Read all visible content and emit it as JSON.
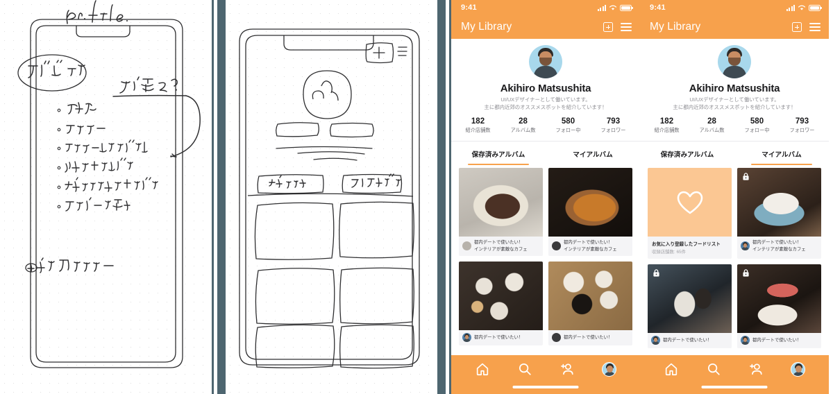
{
  "colors": {
    "accent": "#f7a14c",
    "divider": "#4e6670",
    "fav_bg": "#fbc793",
    "text_dark": "#19191b"
  },
  "sketch_notes": {
    "title": "Pr. file.",
    "circled_label": "プロパティ",
    "tab_change_note": "タブ変え？",
    "bullets": [
      "名前",
      "フォロワー",
      "フォロー中のアカウント",
      "作成したアルバム",
      "お気に入りのアルバム",
      "プロフィール詳細"
    ],
    "footer_note": "◎友だち見てフォロワー"
  },
  "wireframe": {
    "tab_left": "お気に入り",
    "tab_right": "マイアルバム",
    "plus_icon": "plus-box-icon",
    "menu_icon": "hamburger-icon"
  },
  "app": {
    "status": {
      "time": "9:41",
      "signal_icon": "signal-bars-icon",
      "wifi_icon": "wifi-icon",
      "battery_icon": "battery-icon"
    },
    "appbar": {
      "title": "My Library",
      "add_icon": "plus-box-icon",
      "menu_icon": "hamburger-icon"
    },
    "profile": {
      "name": "Akihiro Matsushita",
      "bio_line1": "UI/UXデザイナーとして働いています。",
      "bio_line2": "主に都内近郊のオススメスポットを紹介しています！",
      "avatar": "user-avatar"
    },
    "stats": [
      {
        "value": "182",
        "label": "紹介店舗数"
      },
      {
        "value": "28",
        "label": "アルバム数"
      },
      {
        "value": "580",
        "label": "フォロー中"
      },
      {
        "value": "793",
        "label": "フォロワー"
      }
    ],
    "tabs": [
      {
        "label": "保存済みアルバム"
      },
      {
        "label": "マイアルバム"
      }
    ],
    "card_caption_line1": "都内デートで使いたい！",
    "card_caption_line2": "インテリアが素敵なカフェ",
    "favorite_card": {
      "title": "お気に入り登録したフードリスト",
      "subtitle": "収録店舗数: 65件",
      "icon": "heart-icon"
    },
    "tabbar": {
      "home": "home-icon",
      "search": "search-icon",
      "add_user": "add-person-icon",
      "profile": "avatar-icon"
    }
  },
  "panel3": {
    "active_tab_index": 0
  },
  "panel4": {
    "active_tab_index": 1
  }
}
